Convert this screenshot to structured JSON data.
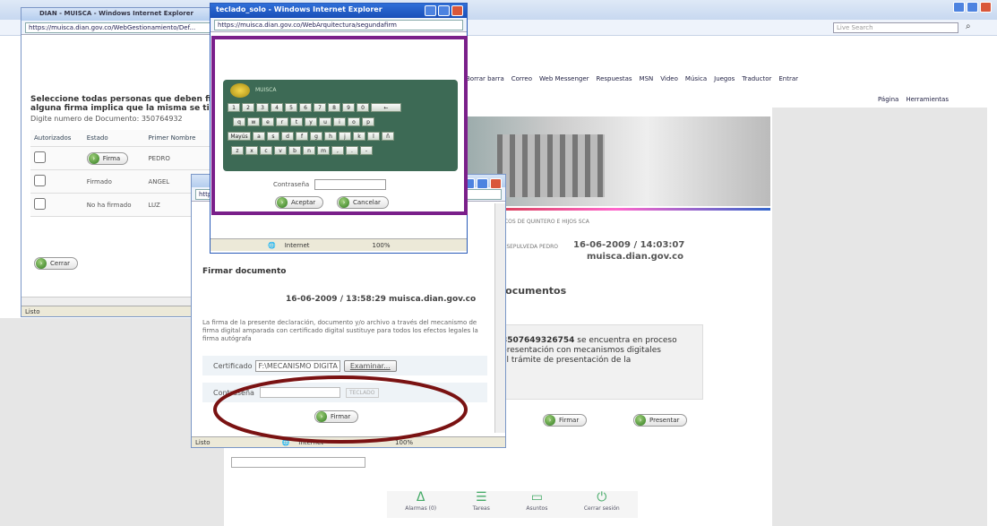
{
  "main_window": {
    "title": "DIAN - MUISCA - Windows Internet Explorer",
    "url": "https://muisca.dian.gov.co/WebGestionamiento/Def...",
    "search_placeholder": "Live Search",
    "links_toolbar": [
      "Borrar barra",
      "Correo",
      "Web Messenger",
      "Respuestas",
      "MSN",
      "Video",
      "Música",
      "Juegos",
      "Traductor",
      "Entrar"
    ],
    "cmd_toolbar": [
      "Página",
      "Herramientas"
    ],
    "header": {
      "company": "ARCOS DE QUINTERO E HIJOS SCA",
      "user": "DE SEPULVEDA PEDRO",
      "datetime": "16-06-2009 / 14:03:07",
      "domain": "muisca.dian.gov.co"
    },
    "section_title": "Documentos",
    "message": {
      "doc_number": "3507649326754",
      "text_line1": "se encuentra en proceso",
      "text_line2": "presentación con mecanismos digitales",
      "text_line3": "al trámite de presentación de la"
    },
    "buttons": {
      "firmar": "Firmar",
      "presentar": "Presentar"
    },
    "bottom_nav": [
      {
        "icon": "Δ",
        "label": "Alarmas (0)"
      },
      {
        "icon": "☰",
        "label": "Tareas"
      },
      {
        "icon": "▭",
        "label": "Asuntos"
      },
      {
        "icon": "⏻",
        "label": "Cerrar sesión"
      }
    ]
  },
  "left_window": {
    "instruction_line1": "Seleccione todas personas que deben fi",
    "instruction_line2": "alguna firma implica que la misma se ti",
    "doc_label": "Digite numero de Documento",
    "doc_value": "350764932",
    "columns": [
      "Autorizados",
      "Estado",
      "Primer Nombre"
    ],
    "rows": [
      {
        "estado": "Firma",
        "nombre": "PEDRO"
      },
      {
        "estado": "Firmado",
        "nombre": "ANGEL"
      },
      {
        "estado": "No ha firmado",
        "nombre": "LUZ"
      }
    ],
    "close_button": "Cerrar",
    "status": "Listo"
  },
  "sign_window": {
    "heading": "Firmar documento",
    "datetime": "16-06-2009 / 13:58:29 muisca.dian.gov.co",
    "legal_text": "La firma de la presente declaración, documento y/o archivo a través del mecanismo de firma digital amparada con certificado digital sustituye para todos los efectos legales la firma autógrafa",
    "cert_label": "Certificado",
    "cert_value": "F:\\MECANISMO DIGITA",
    "browse_button": "Examinar...",
    "password_label": "Contraseña",
    "keyboard_button": "TECLADO",
    "sign_button": "Firmar",
    "status_done": "Listo",
    "status_zone": "Internet",
    "zoom": "100%"
  },
  "keyboard_popup": {
    "title": "teclado_solo - Windows Internet Explorer",
    "url": "https://muisca.dian.gov.co/WebArquitectura/segundafirm",
    "brand": "MUISCA",
    "row1": [
      "1",
      "2",
      "3",
      "4",
      "5",
      "6",
      "7",
      "8",
      "9",
      "0",
      "←"
    ],
    "row2": [
      "q",
      "w",
      "e",
      "r",
      "t",
      "y",
      "u",
      "i",
      "o",
      "p"
    ],
    "row3": [
      "Mayús",
      "a",
      "s",
      "d",
      "f",
      "g",
      "h",
      "j",
      "k",
      "l",
      "ñ"
    ],
    "row4": [
      "z",
      "x",
      "c",
      "v",
      "b",
      "n",
      "m",
      ",",
      ".",
      "-"
    ],
    "password_label": "Contraseña",
    "accept": "Aceptar",
    "cancel": "Cancelar",
    "status_zone": "Internet",
    "zoom": "100%"
  },
  "annotations": {
    "highlight_color": "#7a1f8a",
    "circle_color": "#7a1212"
  }
}
